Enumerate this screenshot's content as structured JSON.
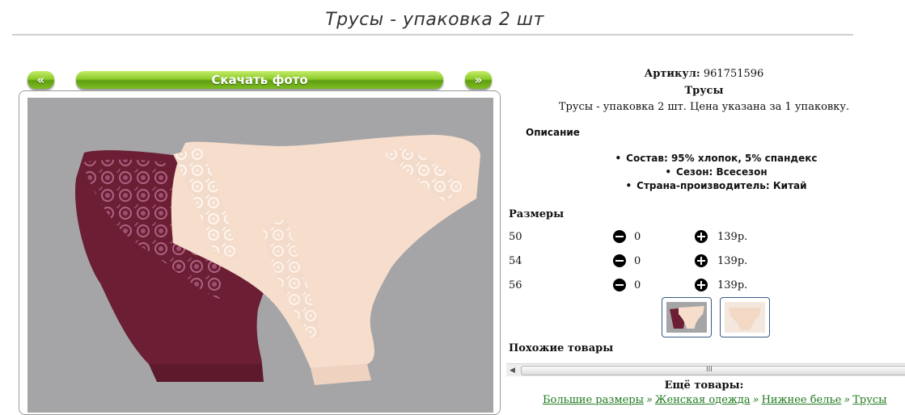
{
  "page": {
    "title": "Трусы - упаковка 2 шт"
  },
  "gallery": {
    "prev_label": "«",
    "download_label": "Скачать фото",
    "next_label": "»"
  },
  "product": {
    "article_label": "Артикул:",
    "article_value": "961751596",
    "name": "Трусы",
    "description": "Трусы - упаковка 2 шт. Цена указана за 1 упаковку.",
    "description_heading": "Описание",
    "features": [
      "Состав: 95% хлопок, 5% спандекс",
      "Сезон: Всесезон",
      "Страна-производитель: Китай"
    ]
  },
  "sizes": {
    "heading": "Размеры",
    "rows": [
      {
        "size": "50",
        "qty": "0",
        "price": "139р."
      },
      {
        "size": "54",
        "qty": "0",
        "price": "139р."
      },
      {
        "size": "56",
        "qty": "0",
        "price": "139р."
      }
    ]
  },
  "similar": {
    "heading": "Похожие товары"
  },
  "scrollbar": {
    "left_arrow": "◀",
    "grip": "III"
  },
  "more": {
    "heading": "Ещё товары:",
    "links": [
      "Большие размеры",
      "Женская одежда",
      "Нижнее белье",
      "Трусы"
    ]
  },
  "icons": {
    "minus": "minus-circle-icon",
    "plus": "plus-circle-icon"
  },
  "colors": {
    "button_green": "#7fbd22",
    "photo_bg": "#a5a5a7",
    "link_green": "#1f7a1f"
  }
}
